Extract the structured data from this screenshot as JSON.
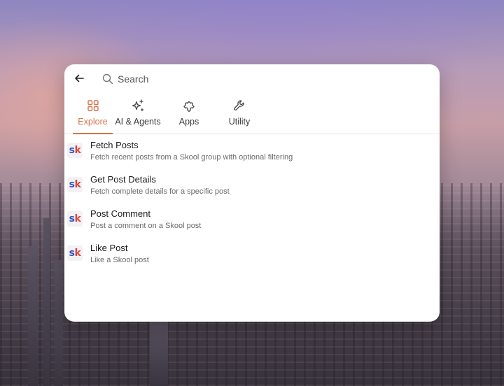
{
  "search": {
    "placeholder": "Search"
  },
  "tabs": [
    {
      "label": "Explore",
      "icon": "grid-icon",
      "active": true
    },
    {
      "label": "AI & Agents",
      "icon": "sparkles-icon",
      "active": false
    },
    {
      "label": "Apps",
      "icon": "puzzle-icon",
      "active": false
    },
    {
      "label": "Utility",
      "icon": "wrench-icon",
      "active": false
    }
  ],
  "items": [
    {
      "logo_s": "s",
      "logo_k": "k",
      "title": "Fetch Posts",
      "description": "Fetch recent posts from a Skool group with optional filtering"
    },
    {
      "logo_s": "s",
      "logo_k": "k",
      "title": "Get Post Details",
      "description": "Fetch complete details for a specific post"
    },
    {
      "logo_s": "s",
      "logo_k": "k",
      "title": "Post Comment",
      "description": "Post a comment on a Skool post"
    },
    {
      "logo_s": "s",
      "logo_k": "k",
      "title": "Like Post",
      "description": "Like a Skool post"
    }
  ],
  "colors": {
    "accent": "#d4734c",
    "logo_blue": "#2f56c6",
    "logo_red": "#e0453a"
  }
}
